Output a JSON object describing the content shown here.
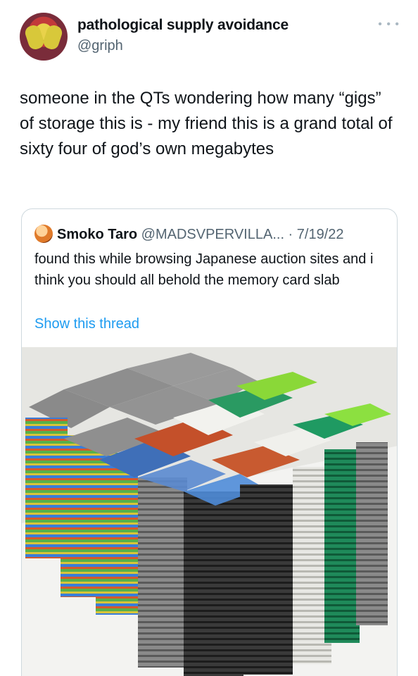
{
  "author": {
    "display_name": "pathological supply avoidance",
    "handle": "@griph",
    "more_icon": "more-horizontal-icon"
  },
  "tweet": {
    "text": "someone in the QTs wondering how many “gigs” of storage this is - my friend this is a grand total of sixty four of god’s own megabytes"
  },
  "quoted": {
    "display_name": "Smoko Taro",
    "handle": "@MADSVPERVILLA...",
    "separator": " · ",
    "date": "7/19/22",
    "text": "found this while browsing Japanese auction sites and i think you should all behold the memory card slab",
    "link": "Show this thread"
  }
}
